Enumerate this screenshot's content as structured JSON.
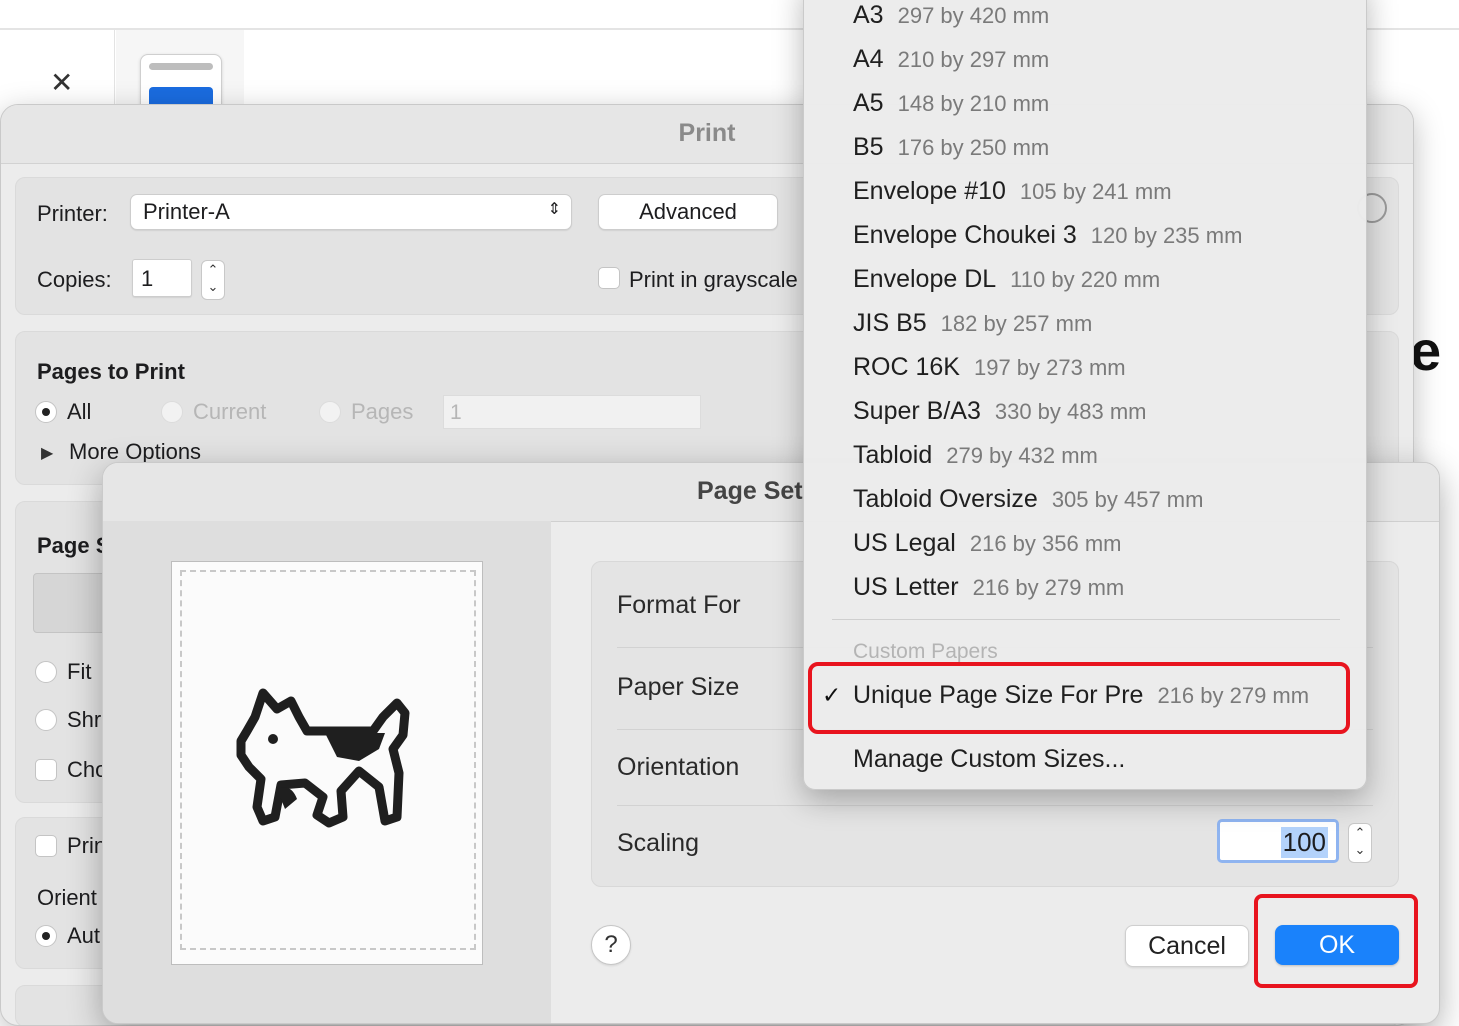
{
  "background_app": {
    "close_glyph": "✕",
    "partial_letter": "e"
  },
  "print_dialog": {
    "title": "Print",
    "printer": {
      "label": "Printer:",
      "value": "Printer-A"
    },
    "advanced_label": "Advanced",
    "copies": {
      "label": "Copies:",
      "value": "1"
    },
    "grayscale_label": "Print in grayscale",
    "pages_to_print": {
      "header": "Pages to Print",
      "all": "All",
      "current": "Current",
      "pages": "Pages",
      "range_value": "1",
      "more_options": "More Options"
    },
    "page_section": {
      "header_partial": "Page S",
      "fit_partial": "Fit",
      "shrink_partial": "Shr",
      "choose_partial": "Cho",
      "print_partial": "Prin",
      "orient_partial": "Orient",
      "auto_partial": "Aut"
    }
  },
  "page_setup": {
    "title": "Page Set",
    "format_for_label": "Format For",
    "paper_size_label": "Paper Size",
    "orientation_label": "Orientation",
    "scaling_label": "Scaling",
    "scaling_value": "100",
    "help_label": "?",
    "cancel_label": "Cancel",
    "ok_label": "OK"
  },
  "paper_menu": {
    "items": [
      {
        "name": "A3",
        "dims": "297 by 420 mm"
      },
      {
        "name": "A4",
        "dims": "210 by 297 mm"
      },
      {
        "name": "A5",
        "dims": "148 by 210 mm"
      },
      {
        "name": "B5",
        "dims": "176 by 250 mm"
      },
      {
        "name": "Envelope #10",
        "dims": "105 by 241 mm"
      },
      {
        "name": "Envelope Choukei 3",
        "dims": "120 by 235 mm"
      },
      {
        "name": "Envelope DL",
        "dims": "110 by 220 mm"
      },
      {
        "name": "JIS B5",
        "dims": "182 by 257 mm"
      },
      {
        "name": "ROC 16K",
        "dims": "197 by 273 mm"
      },
      {
        "name": "Super B/A3",
        "dims": "330 by 483 mm"
      },
      {
        "name": "Tabloid",
        "dims": "279 by 432 mm"
      },
      {
        "name": "Tabloid Oversize",
        "dims": "305 by 457 mm"
      },
      {
        "name": "US Legal",
        "dims": "216 by 356 mm"
      },
      {
        "name": "US Letter",
        "dims": "216 by 279 mm"
      }
    ],
    "custom_header": "Custom Papers",
    "selected": {
      "name": "Unique Page Size For Pre",
      "dims": "216 by 279 mm",
      "check": "✓"
    },
    "manage_label": "Manage Custom Sizes..."
  },
  "colors": {
    "highlight": "#e8141e",
    "accent": "#1a82fb"
  }
}
